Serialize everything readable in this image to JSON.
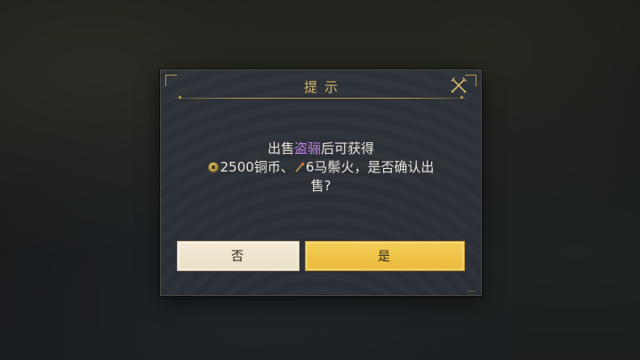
{
  "dialog": {
    "title": "提示",
    "message": {
      "line1_before": "出售",
      "item_name": "盗骊",
      "line1_after": "后可获得",
      "coin_amount": "2500铜币、",
      "reward_item": "6马鬃火，是否确认出",
      "line3": "售?"
    },
    "buttons": {
      "no_label": "否",
      "yes_label": "是"
    }
  },
  "icons": {
    "close": "close-icon",
    "coin": "copper-coin-icon",
    "reward": "horsehair-fire-icon"
  },
  "colors": {
    "title": "#d6b66a",
    "highlight": "#c27ee6",
    "yes_button": "#f0c548",
    "no_button": "#f1e8d2",
    "panel": "#2b2f36"
  }
}
